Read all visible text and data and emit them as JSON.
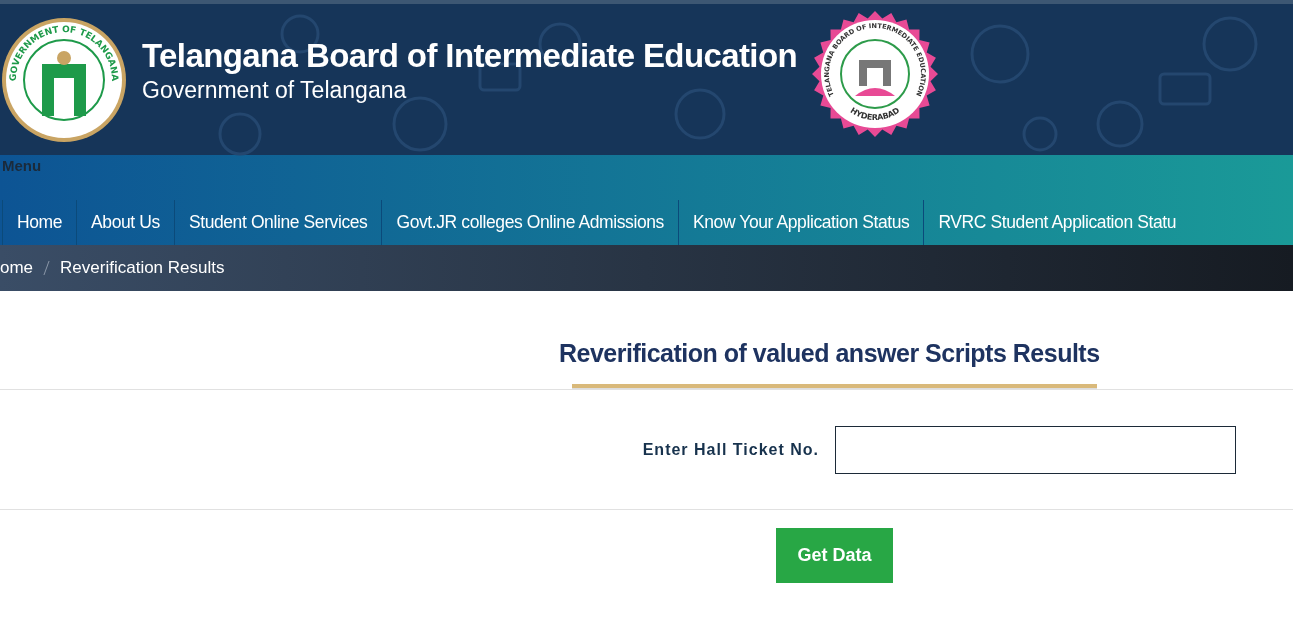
{
  "header": {
    "title": "Telangana Board of Intermediate Education",
    "subtitle": "Government of Telangana",
    "left_emblem_text": "GOVERNMENT OF TELANGANA",
    "right_emblem_text": "TELANGANA BOARD OF INTERMEDIATE EDUCATION",
    "right_emblem_city": "HYDERABAD"
  },
  "menu_label": "Menu",
  "nav": [
    {
      "label": "Home"
    },
    {
      "label": "About Us"
    },
    {
      "label": "Student Online Services"
    },
    {
      "label": "Govt.JR colleges Online Admissions"
    },
    {
      "label": "Know Your Application Status"
    },
    {
      "label": "RVRC Student Application Statu"
    }
  ],
  "breadcrumb": [
    "ome",
    "Reverification Results"
  ],
  "page_title": "Reverification of valued answer Scripts Results",
  "form": {
    "label": "Enter Hall Ticket No.",
    "button": "Get Data"
  }
}
